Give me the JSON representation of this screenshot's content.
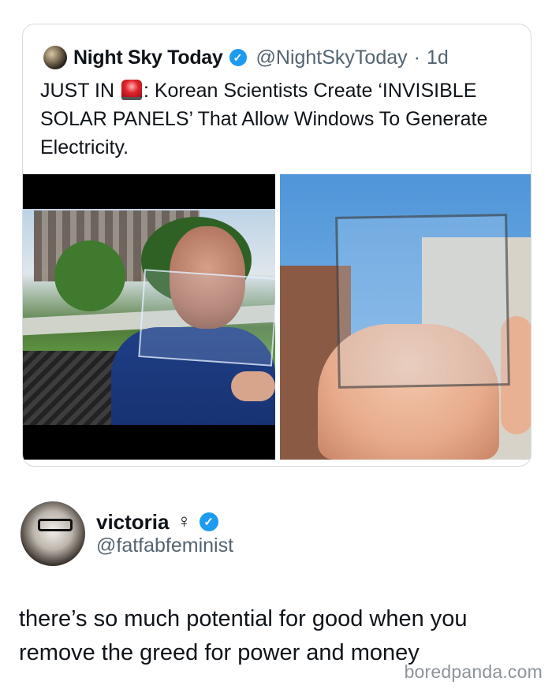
{
  "quoted_tweet": {
    "author_name": "Night Sky Today",
    "author_handle": "@NightSkyToday",
    "separator": "·",
    "time": "1d",
    "text_prefix": "JUST IN",
    "text_body": ": Korean Scientists Create ‘INVISIBLE SOLAR PANELS’ That Allow Windows To Generate Electricity.",
    "emoji": "rotating-light"
  },
  "reply": {
    "author_name": "victoria",
    "author_symbol": "♀",
    "author_handle": "@fatfabfeminist",
    "text": "there’s so much potential for good when you remove the greed for power and money"
  },
  "watermark": "boredpanda.com",
  "icons": {
    "verified": "verified-badge-icon",
    "checkmark": "✓"
  },
  "colors": {
    "verified": "#1d9bf0",
    "handle": "#536471",
    "text": "#0f1419"
  }
}
